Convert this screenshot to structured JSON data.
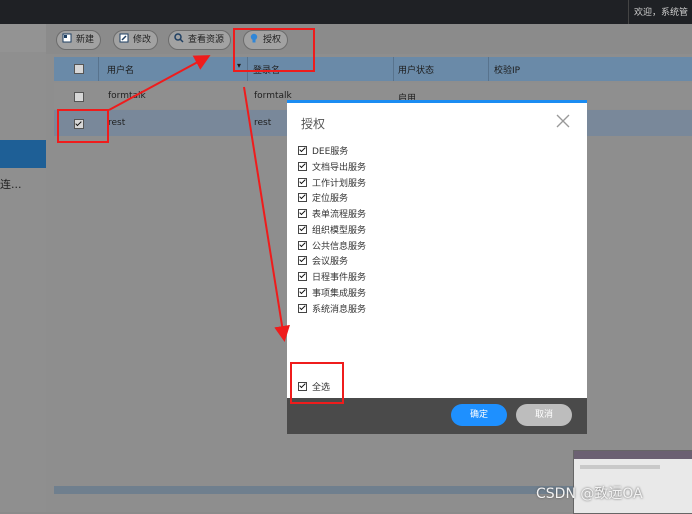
{
  "header": {
    "welcome": "欢迎，系统管"
  },
  "leftnav": {
    "partial_text": "连..."
  },
  "toolbar": {
    "new_label": "新建",
    "edit_label": "修改",
    "view_label": "查看资源",
    "auth_label": "授权"
  },
  "grid": {
    "columns": [
      "用户名",
      "登录名",
      "用户状态",
      "校验IP"
    ],
    "rows": [
      {
        "checked": false,
        "username": "formtalk",
        "login": "formtalk",
        "status": "启用",
        "ip": ""
      },
      {
        "checked": true,
        "username": "rest",
        "login": "rest",
        "status": "",
        "ip": ""
      }
    ]
  },
  "dialog": {
    "title": "授权",
    "services": [
      "DEE服务",
      "文档导出服务",
      "工作计划服务",
      "定位服务",
      "表单流程服务",
      "组织模型服务",
      "公共信息服务",
      "会议服务",
      "日程事件服务",
      "事项集成服务",
      "系统消息服务"
    ],
    "select_all": "全选",
    "ok": "确定",
    "cancel": "取消"
  },
  "watermark": "CSDN @致远OA",
  "colors": {
    "accent": "#1b8cf2",
    "annotation": "#ef1c1c",
    "ok": "#1e90ff"
  }
}
